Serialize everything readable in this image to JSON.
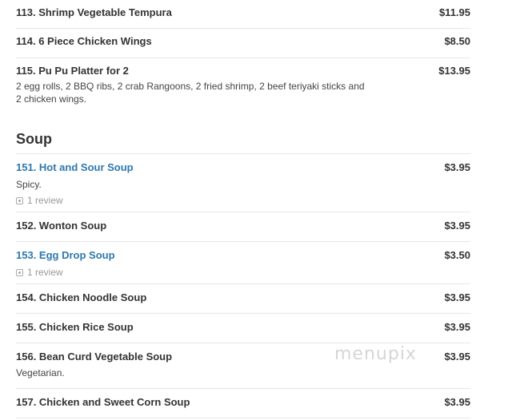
{
  "group1": {
    "items": [
      {
        "name": "113. Shrimp Vegetable Tempura",
        "price": "$11.95"
      },
      {
        "name": "114. 6 Piece Chicken Wings",
        "price": "$8.50"
      },
      {
        "name": "115. Pu Pu Platter for 2",
        "price": "$13.95",
        "description": "2 egg rolls, 2 BBQ ribs, 2 crab Rangoons, 2 fried shrimp, 2 beef teriyaki sticks and 2 chicken wings."
      }
    ]
  },
  "soup": {
    "title": "Soup",
    "items": [
      {
        "name": "151. Hot and Sour Soup",
        "price": "$3.95",
        "description": "Spicy.",
        "review": "1 review"
      },
      {
        "name": "152. Wonton Soup",
        "price": "$3.95"
      },
      {
        "name": "153. Egg Drop Soup",
        "price": "$3.50",
        "review": "1 review"
      },
      {
        "name": "154. Chicken Noodle Soup",
        "price": "$3.95"
      },
      {
        "name": "155. Chicken Rice Soup",
        "price": "$3.95"
      },
      {
        "name": "156. Bean Curd Vegetable Soup",
        "price": "$3.95",
        "description": "Vegetarian."
      },
      {
        "name": "157. Chicken and Sweet Corn Soup",
        "price": "$3.95"
      }
    ]
  },
  "watermark": "menupix"
}
